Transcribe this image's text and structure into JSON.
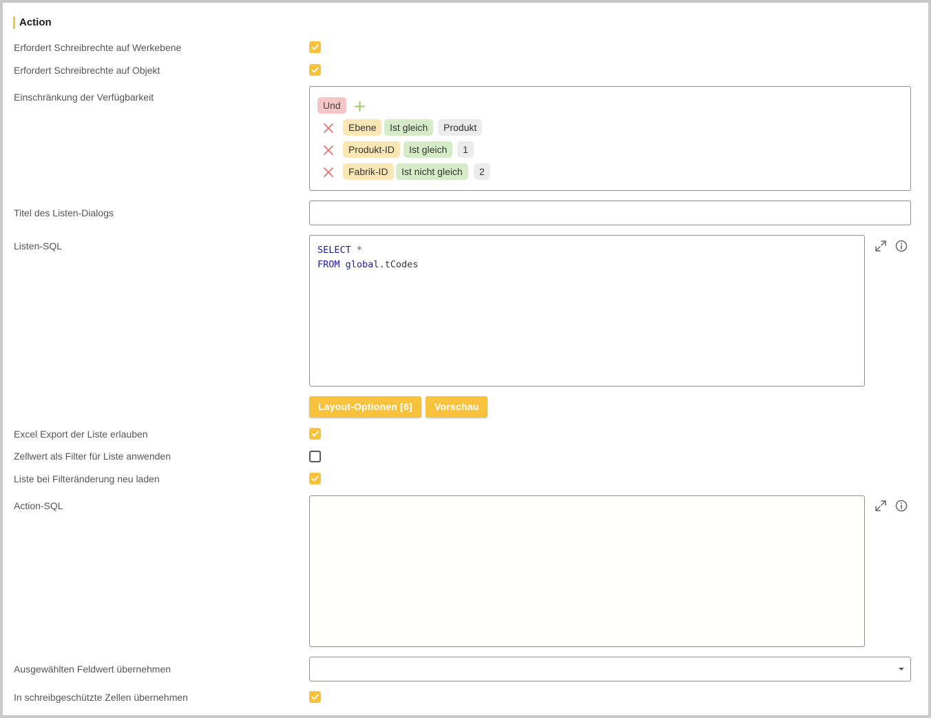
{
  "section": {
    "title": "Action"
  },
  "fields": {
    "write_plant": {
      "label": "Erfordert Schreibrechte auf Werkebene",
      "checked": true
    },
    "write_object": {
      "label": "Erfordert Schreibrechte auf Objekt",
      "checked": true
    },
    "availability": {
      "label": "Einschränkung der Verfügbarkeit",
      "conjunction": "Und",
      "conditions": [
        {
          "field": "Ebene",
          "operator": "Ist gleich",
          "value": "Produkt"
        },
        {
          "field": "Produkt-ID",
          "operator": "Ist gleich",
          "value": "1"
        },
        {
          "field": "Fabrik-ID",
          "operator": "Ist nicht gleich",
          "value": "2"
        }
      ]
    },
    "list_dialog_title": {
      "label": "Titel des Listen-Dialogs",
      "value": ""
    },
    "list_sql": {
      "label": "Listen-SQL",
      "line1_kw": "SELECT",
      "line1_rest": " *",
      "line2_kw": "FROM",
      "line2_schema": "global",
      "line2_rest": ".tCodes"
    },
    "buttons": {
      "layout_options": "Layout-Optionen [6]",
      "preview": "Vorschau"
    },
    "excel_export": {
      "label": "Excel Export der Liste erlauben",
      "checked": true
    },
    "cell_filter": {
      "label": "Zellwert als Filter für Liste anwenden",
      "checked": false
    },
    "reload_on_filter": {
      "label": "Liste bei Filteränderung neu laden",
      "checked": true
    },
    "action_sql": {
      "label": "Action-SQL",
      "value": ""
    },
    "take_field_value": {
      "label": "Ausgewählten Feldwert übernehmen",
      "value": ""
    },
    "readonly_cells": {
      "label": "In schreibgeschützte Zellen übernehmen",
      "checked": true
    }
  },
  "colors": {
    "accent": "#f9c23c",
    "remove": "#e57373",
    "add": "#9ccc65",
    "sql_keyword": "#1a1aa6"
  },
  "icons": [
    "checkmark-icon",
    "close-icon",
    "plus-icon",
    "expand-icon",
    "info-icon",
    "caret-down-icon"
  ]
}
